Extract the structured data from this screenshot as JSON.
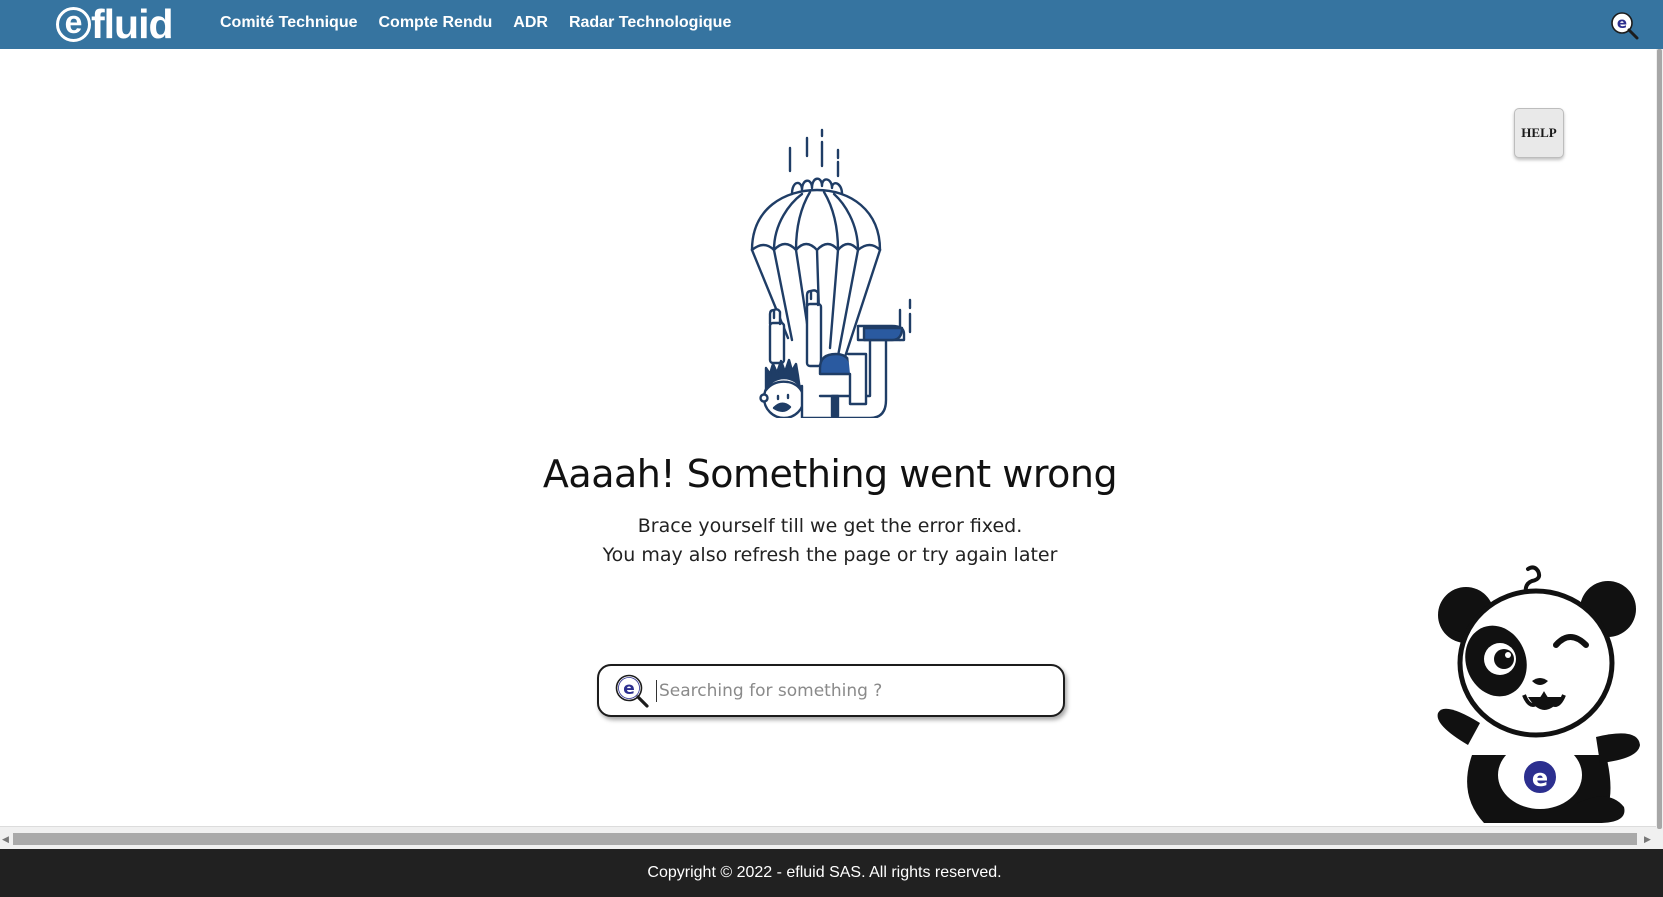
{
  "header": {
    "logo_text": "fluid",
    "logo_letter": "e",
    "nav_items": [
      {
        "label": "Comité Technique"
      },
      {
        "label": "Compte Rendu"
      },
      {
        "label": "ADR"
      },
      {
        "label": "Radar Technologique"
      }
    ],
    "search_icon": "efluid-search-icon"
  },
  "help": {
    "label": "HELP"
  },
  "error": {
    "title": "Aaaah! Something went wrong",
    "line1": "Brace yourself till we get the error fixed.",
    "line2": "You may also refresh the page or try again later"
  },
  "search": {
    "placeholder": "Searching for something ?",
    "value": ""
  },
  "mascot": {
    "badge_letter": "e"
  },
  "footer": {
    "copyright": "Copyright © 2022 - efluid SAS. All rights reserved."
  },
  "colors": {
    "navbar": "#3674a0",
    "footer": "#212121",
    "illustration_stroke": "#1f3d66",
    "illustration_fill": "#2a5aa0",
    "mascot_badge": "#2c2f8f"
  }
}
